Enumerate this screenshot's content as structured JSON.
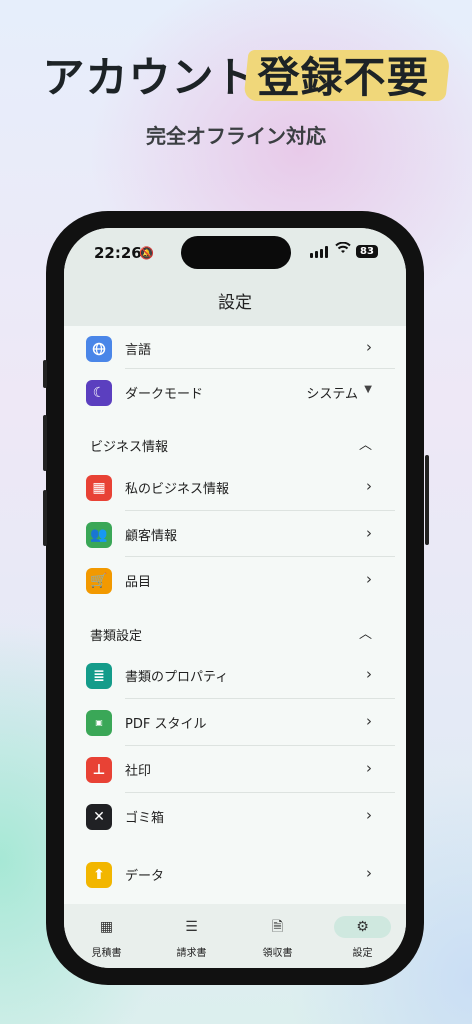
{
  "headline": {
    "part1": "アカウント",
    "part2": "登録不要",
    "subtitle": "完全オフライン対応"
  },
  "status": {
    "time": "22:26",
    "battery": "83"
  },
  "screen_title": "設定",
  "general_items": [
    {
      "label": "言語",
      "icon": "globe-icon",
      "color": "#4a86e8"
    },
    {
      "label": "ダークモード",
      "icon": "moon-icon",
      "color": "#5b3fbf",
      "value": "システム"
    }
  ],
  "business_section": {
    "title": "ビジネス情報",
    "items": [
      {
        "label": "私のビジネス情報",
        "icon": "building-icon",
        "color": "#e84235"
      },
      {
        "label": "顧客情報",
        "icon": "people-icon",
        "color": "#3aa757"
      },
      {
        "label": "品目",
        "icon": "cart-icon",
        "color": "#f29900"
      }
    ]
  },
  "document_section": {
    "title": "書類設定",
    "items": [
      {
        "label": "書類のプロパティ",
        "icon": "list-doc-icon",
        "color": "#149c8a"
      },
      {
        "label": "PDF スタイル",
        "icon": "pdf-icon",
        "color": "#3aa757"
      },
      {
        "label": "社印",
        "icon": "stamp-icon",
        "color": "#e84235"
      },
      {
        "label": "ゴミ箱",
        "icon": "trash-icon",
        "color": "#202124"
      }
    ]
  },
  "data_item": {
    "label": "データ",
    "icon": "upload-icon",
    "color": "#f2b600"
  },
  "tabs": [
    {
      "label": "見積書",
      "icon": "calculator-icon"
    },
    {
      "label": "請求書",
      "icon": "invoice-icon"
    },
    {
      "label": "領収書",
      "icon": "receipt-icon"
    },
    {
      "label": "設定",
      "icon": "gear-icon"
    }
  ]
}
